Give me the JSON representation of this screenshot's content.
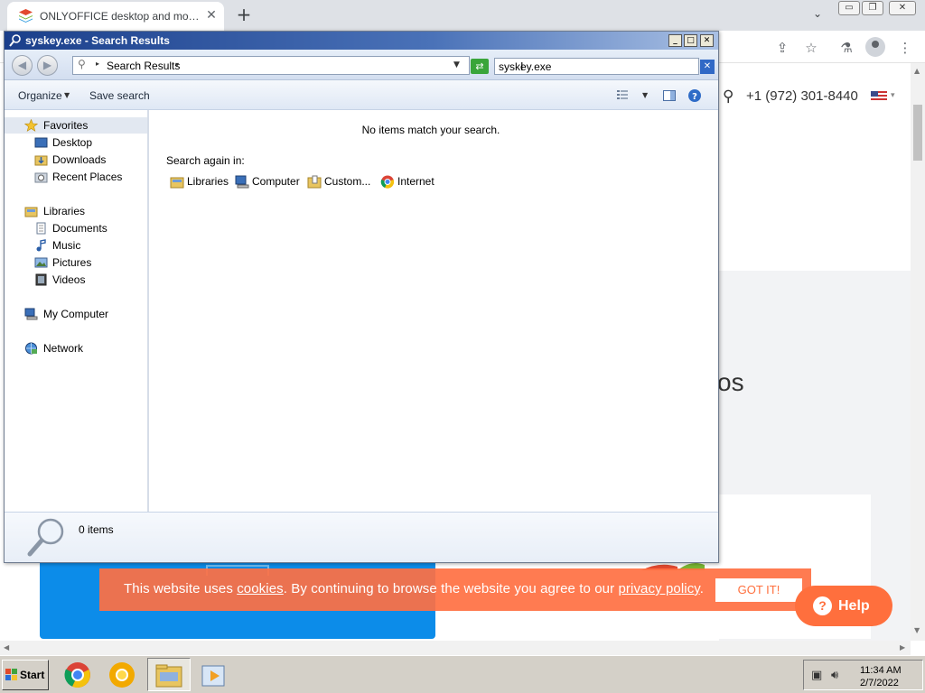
{
  "browser": {
    "tab_title": "ONLYOFFICE desktop and mobile apps",
    "tab_close": "✕",
    "new_tab": "+",
    "tab_dropdown": "⌄",
    "win_minimize": "▭",
    "win_restore": "❐",
    "win_close": "✕",
    "page": {
      "phone": "+1 (972) 301-8440",
      "heading_fragment": "os",
      "cookie_text_before": "This website uses ",
      "cookie_link_cookies": "cookies",
      "cookie_text_middle": ". By continuing to browse the website you agree to our ",
      "cookie_link_privacy": "privacy policy",
      "cookie_text_end": ".",
      "cookie_button": "GOT IT!",
      "help_button": "Help",
      "help_icon": "?"
    }
  },
  "explorer": {
    "title": "syskey.exe - Search Results",
    "address_text": "Search Results",
    "search_value": "syskey.exe",
    "toolbar": {
      "organize": "Organize",
      "save_search": "Save search"
    },
    "nav": {
      "favorites": "Favorites",
      "desktop": "Desktop",
      "downloads": "Downloads",
      "recent_places": "Recent Places",
      "libraries": "Libraries",
      "documents": "Documents",
      "music": "Music",
      "pictures": "Pictures",
      "videos": "Videos",
      "my_computer": "My Computer",
      "network": "Network"
    },
    "content": {
      "empty_message": "No items match your search.",
      "search_again_label": "Search again in:",
      "locations": [
        "Libraries",
        "Computer",
        "Custom...",
        "Internet"
      ]
    },
    "status": {
      "item_count": "0 items"
    }
  },
  "taskbar": {
    "start": "Start",
    "time": "11:34 AM",
    "date": "2/7/2022"
  },
  "colors": {
    "cookie_bar": "#ff7042",
    "help_button": "#ff6f3d",
    "titlebar": "#1b3f8b",
    "blue_card": "#0c8ce9"
  }
}
